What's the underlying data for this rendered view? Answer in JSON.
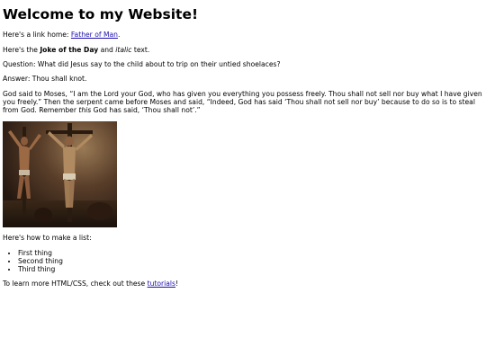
{
  "heading": "Welcome to my Website!",
  "link_line": {
    "prefix": "Here's a link home: ",
    "link_text": "Father of Man",
    "suffix": "."
  },
  "joke_line": {
    "prefix": "Here's the ",
    "bold": "Joke of the Day",
    "middle": " and ",
    "italic": "italic",
    "suffix": " text."
  },
  "question": "Question: What did Jesus say to the child about to trip on their untied shoelaces?",
  "answer": "Answer: Thou shall knot.",
  "story": {
    "text": "God said to Moses, “I am the Lord your God, who has given you everything you possess freely. Thou shall not sell nor buy what I have given you freely.” Then the serpent came before Moses and said, “Indeed, God has said ‘Thou shall not sell nor buy’ because to do so is to steal from God. Remember ",
    "italic": "this",
    "suffix": " God has said, ‘Thou shall not’.”"
  },
  "list_intro": "Here's how to make a list:",
  "list_items": [
    "First thing",
    "Second thing",
    "Third thing"
  ],
  "footer_line": {
    "prefix": "To learn more HTML/CSS, check out these ",
    "link_text": "tutorials",
    "suffix": "!"
  },
  "colors": {
    "link": "#1a0dab",
    "text": "#000000",
    "background": "#ffffff"
  }
}
